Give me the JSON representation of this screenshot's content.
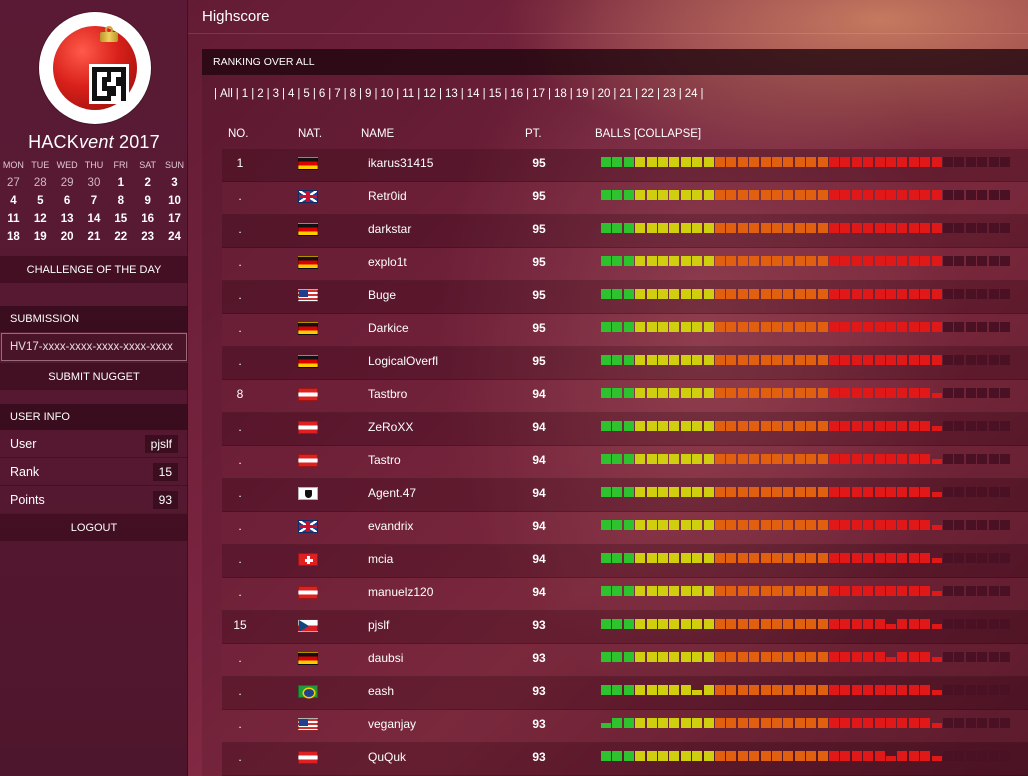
{
  "colors": {
    "ball_green": "#2fc22f",
    "ball_yellow": "#cfcf10",
    "ball_orange": "#e06010",
    "ball_red": "#e01818",
    "ball_empty": "#4a1024"
  },
  "sidebar": {
    "logo_icon": "christmas-ornament-qr-icon",
    "brand_prefix": "HACK",
    "brand_italic": "vent",
    "brand_year": "2017",
    "calendar": {
      "weekdays": [
        "MON",
        "TUE",
        "WED",
        "THU",
        "FRI",
        "SAT",
        "SUN"
      ],
      "weeks": [
        [
          "27",
          "28",
          "29",
          "30",
          "1",
          "2",
          "3"
        ],
        [
          "4",
          "5",
          "6",
          "7",
          "8",
          "9",
          "10"
        ],
        [
          "11",
          "12",
          "13",
          "14",
          "15",
          "16",
          "17"
        ],
        [
          "18",
          "19",
          "20",
          "21",
          "22",
          "23",
          "24"
        ]
      ]
    },
    "challenge_label": "CHALLENGE OF THE DAY",
    "submission_label": "SUBMISSION",
    "nugget_value": "HV17-xxxx-xxxx-xxxx-xxxx-xxxx",
    "submit_label": "SUBMIT NUGGET",
    "user_info_label": "USER INFO",
    "user_label": "User",
    "user_value": "pjslf",
    "rank_label": "Rank",
    "rank_value": "15",
    "points_label": "Points",
    "points_value": "93",
    "logout_label": "LOGOUT"
  },
  "header": {
    "title": "Highscore"
  },
  "panel": {
    "title": "RANKING OVER ALL",
    "day_links": [
      "All",
      "1",
      "2",
      "3",
      "4",
      "5",
      "6",
      "7",
      "8",
      "9",
      "10",
      "11",
      "12",
      "13",
      "14",
      "15",
      "16",
      "17",
      "18",
      "19",
      "20",
      "21",
      "22",
      "23",
      "24"
    ]
  },
  "table": {
    "columns": {
      "no": "NO.",
      "nat": "NAT.",
      "name": "NAME",
      "pt": "PT.",
      "balls": "BALLS [COLLAPSE]"
    },
    "rows": [
      {
        "no": "1",
        "flag": "de",
        "name": "ikarus31415",
        "pt": "95",
        "balls": "GGGYYYYYYYOOOOOOOOOORRRRRRRRRREEEEEE"
      },
      {
        "no": ".",
        "flag": "gb",
        "name": "Retr0id",
        "pt": "95",
        "balls": "GGGYYYYYYYOOOOOOOOOORRRRRRRRRREEEEEE"
      },
      {
        "no": ".",
        "flag": "de",
        "name": "darkstar",
        "pt": "95",
        "balls": "GGGYYYYYYYOOOOOOOOOORRRRRRRRRREEEEEE"
      },
      {
        "no": ".",
        "flag": "de",
        "name": "explo1t",
        "pt": "95",
        "balls": "GGGYYYYYYYOOOOOOOOOORRRRRRRRRREEEEEE"
      },
      {
        "no": ".",
        "flag": "us",
        "name": "Buge",
        "pt": "95",
        "balls": "GGGYYYYYYYOOOOOOOOOORRRRRRRRRREEEEEE"
      },
      {
        "no": ".",
        "flag": "de",
        "name": "Darkice",
        "pt": "95",
        "balls": "GGGYYYYYYYOOOOOOOOOORRRRRRRRRREEEEEE"
      },
      {
        "no": ".",
        "flag": "de",
        "name": "LogicalOverfl",
        "pt": "95",
        "balls": "GGGYYYYYYYOOOOOOOOOORRRRRRRRRREEEEEE"
      },
      {
        "no": "8",
        "flag": "at",
        "name": "Tastbro",
        "pt": "94",
        "balls": "GGGYYYYYYYOOOOOOOOOORRRRRRRRRrEEEEEE"
      },
      {
        "no": ".",
        "flag": "at",
        "name": "ZeRoXX",
        "pt": "94",
        "balls": "GGGYYYYYYYOOOOOOOOOORRRRRRRRRrEEEEEE"
      },
      {
        "no": ".",
        "flag": "at",
        "name": "Tastro",
        "pt": "94",
        "balls": "GGGYYYYYYYOOOOOOOOOORRRRRRRRRrEEEEEE"
      },
      {
        "no": ".",
        "flag": "pi",
        "name": "Agent.47",
        "pt": "94",
        "balls": "GGGYYYYYYYOOOOOOOOOORRRRRRRRRrEEEEEE"
      },
      {
        "no": ".",
        "flag": "gb",
        "name": "evandrix",
        "pt": "94",
        "balls": "GGGYYYYYYYOOOOOOOOOORRRRRRRRRrEEEEEE"
      },
      {
        "no": ".",
        "flag": "ch",
        "name": "mcia",
        "pt": "94",
        "balls": "GGGYYYYYYYOOOOOOOOOORRRRRRRRRrEEEEEE"
      },
      {
        "no": ".",
        "flag": "at",
        "name": "manuelz120",
        "pt": "94",
        "balls": "GGGYYYYYYYOOOOOOOOOORRRRRRRRRrEEEEEE"
      },
      {
        "no": "15",
        "flag": "cz",
        "name": "pjslf",
        "pt": "93",
        "balls": "GGGYYYYYYYOOOOOOOOOORRRRRrRRRrEEEEEE"
      },
      {
        "no": ".",
        "flag": "de",
        "name": "daubsi",
        "pt": "93",
        "balls": "GGGYYYYYYYOOOOOOOOOORRRRRrRRRrEEEEEE"
      },
      {
        "no": ".",
        "flag": "br",
        "name": "eash",
        "pt": "93",
        "balls": "GGGYYYYYyYOOOOOOOOOORRRRRRRRRrEEEEEE"
      },
      {
        "no": ".",
        "flag": "us",
        "name": "veganjay",
        "pt": "93",
        "balls": "gGGYYYYYYYOOOOOOOOOORRRRRRRRRrEEEEEE"
      },
      {
        "no": ".",
        "flag": "at",
        "name": "QuQuk",
        "pt": "93",
        "balls": "GGGYYYYYYYOOOOOOOOOORRRRRrRRRrEEEEEE"
      }
    ]
  }
}
